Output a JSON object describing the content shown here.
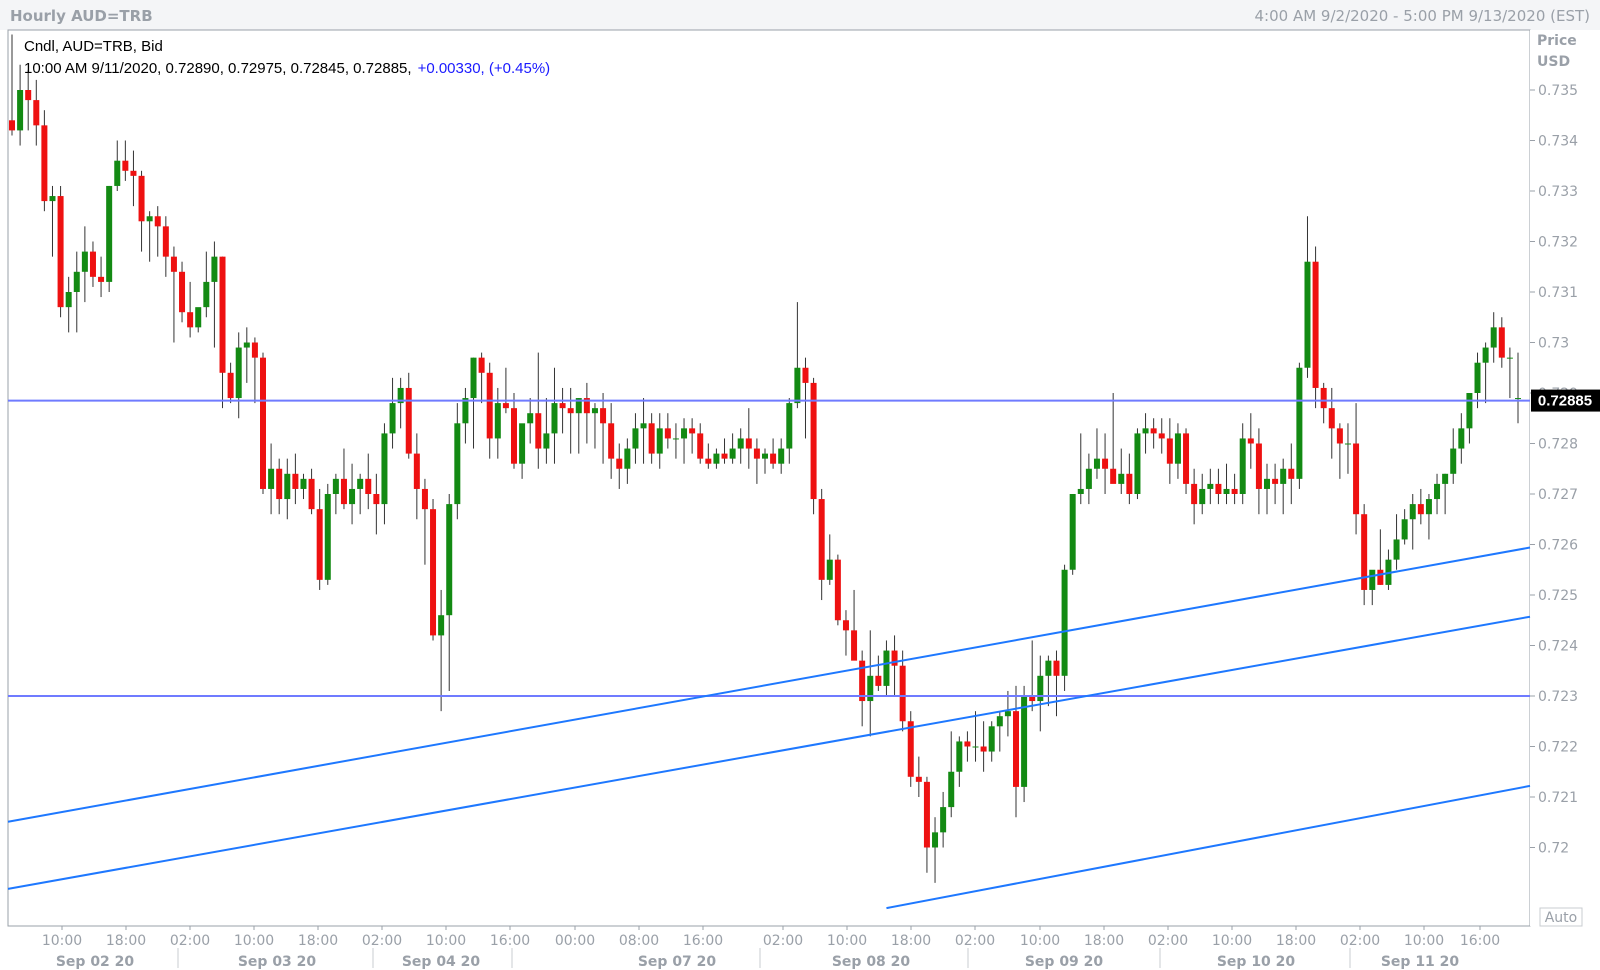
{
  "header": {
    "title": "Hourly AUD=TRB",
    "range": "4:00 AM 9/2/2020 - 5:00 PM 9/13/2020 (EST)"
  },
  "legend": {
    "series_label": "Cndl, AUD=TRB, Bid",
    "ohlc_line": "10:00 AM 9/11/2020, 0.72890, 0.72975, 0.72845, 0.72885,",
    "change": "+0.00330, (+0.45%)"
  },
  "price_axis": {
    "title_line1": "Price",
    "title_line2": "USD",
    "ticks": [
      "0.735",
      "0.734",
      "0.733",
      "0.732",
      "0.731",
      "0.73",
      "0.729",
      "0.728",
      "0.727",
      "0.726",
      "0.725",
      "0.724",
      "0.723",
      "0.722",
      "0.721",
      "0.72"
    ],
    "current_label": "0.72885",
    "auto_label": "Auto"
  },
  "time_axis": {
    "hour_labels": [
      "10:00",
      "18:00",
      "02:00",
      "10:00",
      "18:00",
      "02:00",
      "10:00",
      "16:00",
      "00:00",
      "08:00",
      "16:00",
      "02:00",
      "10:00",
      "18:00",
      "02:00",
      "10:00",
      "18:00",
      "02:00",
      "10:00",
      "18:00",
      "02:00",
      "10:00",
      "16:00"
    ],
    "date_labels": [
      "Sep 02 20",
      "Sep 03 20",
      "Sep 04 20",
      "Sep 07 20",
      "Sep 08 20",
      "Sep 09 20",
      "Sep 10 20",
      "Sep 11 20"
    ]
  },
  "colors": {
    "up": "#138a13",
    "down": "#ee1111",
    "wick": "#333333",
    "horizontal_line": "#6f7bff",
    "trend_line": "#1e78ff",
    "axis_text": "#9aa0a8",
    "last_price_bg": "#000000"
  },
  "chart_data": {
    "type": "candlestick",
    "title": "Hourly AUD=TRB",
    "ylabel": "Price USD",
    "ylim": [
      0.7193,
      0.7363
    ],
    "ohlc": [
      [
        0.7344,
        0.7361,
        0.7341,
        0.7342
      ],
      [
        0.7342,
        0.7355,
        0.7339,
        0.735
      ],
      [
        0.735,
        0.7354,
        0.7342,
        0.7348
      ],
      [
        0.7348,
        0.7352,
        0.7339,
        0.7343
      ],
      [
        0.7343,
        0.7346,
        0.7326,
        0.7328
      ],
      [
        0.7328,
        0.7331,
        0.7317,
        0.7329
      ],
      [
        0.7329,
        0.7331,
        0.7305,
        0.7307
      ],
      [
        0.7307,
        0.7313,
        0.7302,
        0.731
      ],
      [
        0.731,
        0.7318,
        0.7302,
        0.7314
      ],
      [
        0.7314,
        0.7323,
        0.7308,
        0.7318
      ],
      [
        0.7318,
        0.732,
        0.7311,
        0.7313
      ],
      [
        0.7313,
        0.7317,
        0.7309,
        0.7312
      ],
      [
        0.7312,
        0.7331,
        0.731,
        0.7331
      ],
      [
        0.7331,
        0.734,
        0.733,
        0.7336
      ],
      [
        0.7336,
        0.734,
        0.7332,
        0.7334
      ],
      [
        0.7334,
        0.7338,
        0.7327,
        0.7333
      ],
      [
        0.7333,
        0.7334,
        0.7318,
        0.7324
      ],
      [
        0.7324,
        0.7326,
        0.7316,
        0.7325
      ],
      [
        0.7325,
        0.7327,
        0.7317,
        0.7323
      ],
      [
        0.7323,
        0.7325,
        0.7313,
        0.7317
      ],
      [
        0.7317,
        0.7319,
        0.73,
        0.7314
      ],
      [
        0.7314,
        0.7316,
        0.7304,
        0.7306
      ],
      [
        0.7306,
        0.7312,
        0.7301,
        0.7303
      ],
      [
        0.7303,
        0.7305,
        0.7302,
        0.7307
      ],
      [
        0.7307,
        0.7318,
        0.7305,
        0.7312
      ],
      [
        0.7312,
        0.732,
        0.7299,
        0.7317
      ],
      [
        0.7317,
        0.7317,
        0.7287,
        0.7294
      ],
      [
        0.7294,
        0.7296,
        0.7288,
        0.7289
      ],
      [
        0.7289,
        0.7302,
        0.7285,
        0.7299
      ],
      [
        0.7299,
        0.7303,
        0.7292,
        0.73
      ],
      [
        0.73,
        0.7301,
        0.7288,
        0.7297
      ],
      [
        0.7297,
        0.7298,
        0.727,
        0.7271
      ],
      [
        0.7271,
        0.728,
        0.7266,
        0.7275
      ],
      [
        0.7275,
        0.7277,
        0.7266,
        0.7269
      ],
      [
        0.7269,
        0.7277,
        0.7265,
        0.7274
      ],
      [
        0.7274,
        0.7278,
        0.7268,
        0.7271
      ],
      [
        0.7271,
        0.7274,
        0.7269,
        0.7273
      ],
      [
        0.7273,
        0.7275,
        0.7266,
        0.7267
      ],
      [
        0.7267,
        0.7271,
        0.7251,
        0.7253
      ],
      [
        0.7253,
        0.7272,
        0.7252,
        0.727
      ],
      [
        0.727,
        0.7274,
        0.7266,
        0.7273
      ],
      [
        0.7273,
        0.7279,
        0.7267,
        0.7268
      ],
      [
        0.7268,
        0.7276,
        0.7264,
        0.7271
      ],
      [
        0.7271,
        0.7274,
        0.7266,
        0.7273
      ],
      [
        0.7273,
        0.7278,
        0.7267,
        0.727
      ],
      [
        0.727,
        0.7274,
        0.7262,
        0.7268
      ],
      [
        0.7268,
        0.7284,
        0.7264,
        0.7282
      ],
      [
        0.7282,
        0.7293,
        0.7279,
        0.7288
      ],
      [
        0.7288,
        0.7293,
        0.7283,
        0.7291
      ],
      [
        0.7291,
        0.7294,
        0.7277,
        0.7278
      ],
      [
        0.7278,
        0.7282,
        0.7265,
        0.7271
      ],
      [
        0.7271,
        0.7273,
        0.7256,
        0.7267
      ],
      [
        0.7267,
        0.7269,
        0.7241,
        0.7242
      ],
      [
        0.7242,
        0.7251,
        0.7227,
        0.7246
      ],
      [
        0.7246,
        0.727,
        0.7231,
        0.7268
      ],
      [
        0.7268,
        0.7288,
        0.7265,
        0.7284
      ],
      [
        0.7284,
        0.7291,
        0.728,
        0.7289
      ],
      [
        0.7289,
        0.7297,
        0.7279,
        0.7297
      ],
      [
        0.7297,
        0.7298,
        0.7288,
        0.7294
      ],
      [
        0.7294,
        0.7296,
        0.7277,
        0.7281
      ],
      [
        0.7281,
        0.7291,
        0.7277,
        0.7288
      ],
      [
        0.7288,
        0.7295,
        0.7286,
        0.7287
      ],
      [
        0.7287,
        0.729,
        0.7275,
        0.7276
      ],
      [
        0.7276,
        0.7283,
        0.7273,
        0.7284
      ],
      [
        0.7284,
        0.7289,
        0.728,
        0.7286
      ],
      [
        0.7286,
        0.7298,
        0.7275,
        0.7279
      ],
      [
        0.7279,
        0.7289,
        0.7276,
        0.7282
      ],
      [
        0.7282,
        0.7295,
        0.7276,
        0.7288
      ],
      [
        0.7288,
        0.7291,
        0.7282,
        0.7287
      ],
      [
        0.7287,
        0.7291,
        0.7278,
        0.7286
      ],
      [
        0.7286,
        0.7289,
        0.7278,
        0.7289
      ],
      [
        0.7289,
        0.7292,
        0.728,
        0.7286
      ],
      [
        0.7286,
        0.7288,
        0.7279,
        0.7287
      ],
      [
        0.7287,
        0.729,
        0.7276,
        0.7284
      ],
      [
        0.7284,
        0.7288,
        0.7273,
        0.7277
      ],
      [
        0.7277,
        0.728,
        0.7271,
        0.7275
      ],
      [
        0.7275,
        0.7281,
        0.7272,
        0.7279
      ],
      [
        0.7279,
        0.7286,
        0.7276,
        0.7283
      ],
      [
        0.7283,
        0.7289,
        0.7276,
        0.7284
      ],
      [
        0.7284,
        0.7286,
        0.7276,
        0.7278
      ],
      [
        0.7278,
        0.7286,
        0.7275,
        0.7283
      ],
      [
        0.7283,
        0.7286,
        0.7279,
        0.7281
      ],
      [
        0.7281,
        0.7284,
        0.7277,
        0.7281
      ],
      [
        0.7281,
        0.7285,
        0.7276,
        0.7283
      ],
      [
        0.7283,
        0.7285,
        0.7278,
        0.7282
      ],
      [
        0.7282,
        0.7284,
        0.7276,
        0.7277
      ],
      [
        0.7277,
        0.728,
        0.7275,
        0.7276
      ],
      [
        0.7276,
        0.7279,
        0.7275,
        0.7278
      ],
      [
        0.7278,
        0.7281,
        0.7276,
        0.7277
      ],
      [
        0.7277,
        0.7282,
        0.7276,
        0.7279
      ],
      [
        0.7279,
        0.7283,
        0.7276,
        0.7281
      ],
      [
        0.7281,
        0.7287,
        0.7275,
        0.7279
      ],
      [
        0.7279,
        0.7281,
        0.7272,
        0.7277
      ],
      [
        0.7277,
        0.7279,
        0.7274,
        0.7278
      ],
      [
        0.7278,
        0.7281,
        0.7275,
        0.7276
      ],
      [
        0.7276,
        0.7281,
        0.7274,
        0.7279
      ],
      [
        0.7279,
        0.7289,
        0.7276,
        0.7288
      ],
      [
        0.7288,
        0.7308,
        0.7287,
        0.7295
      ],
      [
        0.7295,
        0.7297,
        0.7281,
        0.7292
      ],
      [
        0.7292,
        0.7293,
        0.7266,
        0.7269
      ],
      [
        0.7269,
        0.7271,
        0.7249,
        0.7253
      ],
      [
        0.7253,
        0.7262,
        0.7252,
        0.7257
      ],
      [
        0.7257,
        0.7258,
        0.7244,
        0.7245
      ],
      [
        0.7245,
        0.7247,
        0.7238,
        0.7243
      ],
      [
        0.7243,
        0.7251,
        0.7238,
        0.7237
      ],
      [
        0.7237,
        0.7239,
        0.7224,
        0.7229
      ],
      [
        0.7229,
        0.7243,
        0.7222,
        0.7234
      ],
      [
        0.7234,
        0.7238,
        0.7231,
        0.7232
      ],
      [
        0.7232,
        0.7241,
        0.723,
        0.7239
      ],
      [
        0.7239,
        0.7242,
        0.723,
        0.7236
      ],
      [
        0.7236,
        0.7239,
        0.7223,
        0.7225
      ],
      [
        0.7225,
        0.7227,
        0.7212,
        0.7214
      ],
      [
        0.7214,
        0.7218,
        0.721,
        0.7213
      ],
      [
        0.7213,
        0.7214,
        0.7195,
        0.72
      ],
      [
        0.72,
        0.7206,
        0.7193,
        0.7203
      ],
      [
        0.7203,
        0.7211,
        0.72,
        0.7208
      ],
      [
        0.7208,
        0.7223,
        0.7206,
        0.7215
      ],
      [
        0.7215,
        0.7222,
        0.7212,
        0.7221
      ],
      [
        0.7221,
        0.7223,
        0.7217,
        0.722
      ],
      [
        0.722,
        0.7227,
        0.7217,
        0.722
      ],
      [
        0.722,
        0.7225,
        0.7215,
        0.7219
      ],
      [
        0.7219,
        0.7225,
        0.7217,
        0.7224
      ],
      [
        0.7224,
        0.7227,
        0.7219,
        0.7226
      ],
      [
        0.7226,
        0.7231,
        0.7222,
        0.7227
      ],
      [
        0.7227,
        0.7232,
        0.7206,
        0.7212
      ],
      [
        0.7212,
        0.7232,
        0.7209,
        0.723
      ],
      [
        0.723,
        0.7241,
        0.7227,
        0.7229
      ],
      [
        0.7229,
        0.7238,
        0.7223,
        0.7234
      ],
      [
        0.7234,
        0.7238,
        0.7228,
        0.7237
      ],
      [
        0.7237,
        0.7239,
        0.7226,
        0.7234
      ],
      [
        0.7234,
        0.7256,
        0.7231,
        0.7255
      ],
      [
        0.7255,
        0.727,
        0.7254,
        0.727
      ],
      [
        0.727,
        0.7282,
        0.7268,
        0.7271
      ],
      [
        0.7271,
        0.7278,
        0.7268,
        0.7275
      ],
      [
        0.7275,
        0.7283,
        0.7273,
        0.7277
      ],
      [
        0.7277,
        0.7282,
        0.727,
        0.7275
      ],
      [
        0.7275,
        0.729,
        0.7273,
        0.7272
      ],
      [
        0.7272,
        0.7279,
        0.727,
        0.7274
      ],
      [
        0.7274,
        0.7278,
        0.7268,
        0.727
      ],
      [
        0.727,
        0.7283,
        0.7269,
        0.7282
      ],
      [
        0.7282,
        0.7286,
        0.7278,
        0.7283
      ],
      [
        0.7283,
        0.7285,
        0.7279,
        0.7282
      ],
      [
        0.7282,
        0.7285,
        0.7278,
        0.7281
      ],
      [
        0.7281,
        0.7285,
        0.7272,
        0.7276
      ],
      [
        0.7276,
        0.7284,
        0.7273,
        0.7282
      ],
      [
        0.7282,
        0.7283,
        0.727,
        0.7272
      ],
      [
        0.7272,
        0.7275,
        0.7264,
        0.7268
      ],
      [
        0.7268,
        0.7274,
        0.7266,
        0.7271
      ],
      [
        0.7271,
        0.7275,
        0.7268,
        0.7272
      ],
      [
        0.7272,
        0.7275,
        0.7268,
        0.727
      ],
      [
        0.727,
        0.7276,
        0.7268,
        0.7271
      ],
      [
        0.7271,
        0.7274,
        0.7268,
        0.727
      ],
      [
        0.727,
        0.7284,
        0.7268,
        0.7281
      ],
      [
        0.7281,
        0.7286,
        0.7275,
        0.728
      ],
      [
        0.728,
        0.7283,
        0.7266,
        0.7271
      ],
      [
        0.7271,
        0.7276,
        0.7266,
        0.7273
      ],
      [
        0.7273,
        0.7276,
        0.7268,
        0.7272
      ],
      [
        0.7272,
        0.7277,
        0.7266,
        0.7275
      ],
      [
        0.7275,
        0.728,
        0.7268,
        0.7273
      ],
      [
        0.7273,
        0.7296,
        0.7271,
        0.7295
      ],
      [
        0.7295,
        0.7325,
        0.7293,
        0.7316
      ],
      [
        0.7316,
        0.7319,
        0.7287,
        0.7291
      ],
      [
        0.7291,
        0.7292,
        0.7284,
        0.7287
      ],
      [
        0.7287,
        0.7291,
        0.7277,
        0.7283
      ],
      [
        0.7283,
        0.7284,
        0.7273,
        0.728
      ],
      [
        0.728,
        0.7284,
        0.7274,
        0.728
      ],
      [
        0.728,
        0.7288,
        0.7262,
        0.7266
      ],
      [
        0.7266,
        0.7268,
        0.7248,
        0.7251
      ],
      [
        0.7251,
        0.7254,
        0.7248,
        0.7255
      ],
      [
        0.7255,
        0.7263,
        0.7252,
        0.7252
      ],
      [
        0.7252,
        0.7259,
        0.7251,
        0.7257
      ],
      [
        0.7257,
        0.7266,
        0.7255,
        0.7261
      ],
      [
        0.7261,
        0.7267,
        0.726,
        0.7265
      ],
      [
        0.7265,
        0.727,
        0.7259,
        0.7268
      ],
      [
        0.7268,
        0.7271,
        0.7264,
        0.7266
      ],
      [
        0.7266,
        0.727,
        0.7261,
        0.7269
      ],
      [
        0.7269,
        0.7274,
        0.7266,
        0.7272
      ],
      [
        0.7272,
        0.7274,
        0.7266,
        0.7274
      ],
      [
        0.7274,
        0.7283,
        0.7272,
        0.7279
      ],
      [
        0.7279,
        0.7286,
        0.7276,
        0.7283
      ],
      [
        0.7283,
        0.7288,
        0.728,
        0.729
      ],
      [
        0.729,
        0.7298,
        0.7287,
        0.7296
      ],
      [
        0.7296,
        0.73,
        0.7288,
        0.7299
      ],
      [
        0.7299,
        0.7306,
        0.7296,
        0.7303
      ],
      [
        0.7303,
        0.7305,
        0.7295,
        0.7297
      ],
      [
        0.7297,
        0.7299,
        0.7289,
        0.7297
      ],
      [
        0.7289,
        0.7298,
        0.7284,
        0.7289
      ]
    ],
    "horizontal_lines": [
      0.72885,
      0.723
    ],
    "trend_lines": [
      {
        "x1": 0,
        "y1": 0.72051,
        "x2": 197,
        "y2": 0.72594
      },
      {
        "x1": 0,
        "y1": 0.71918,
        "x2": 197,
        "y2": 0.72457
      },
      {
        "x1": 108,
        "y1": 0.7188,
        "x2": 197,
        "y2": 0.72122
      }
    ]
  }
}
